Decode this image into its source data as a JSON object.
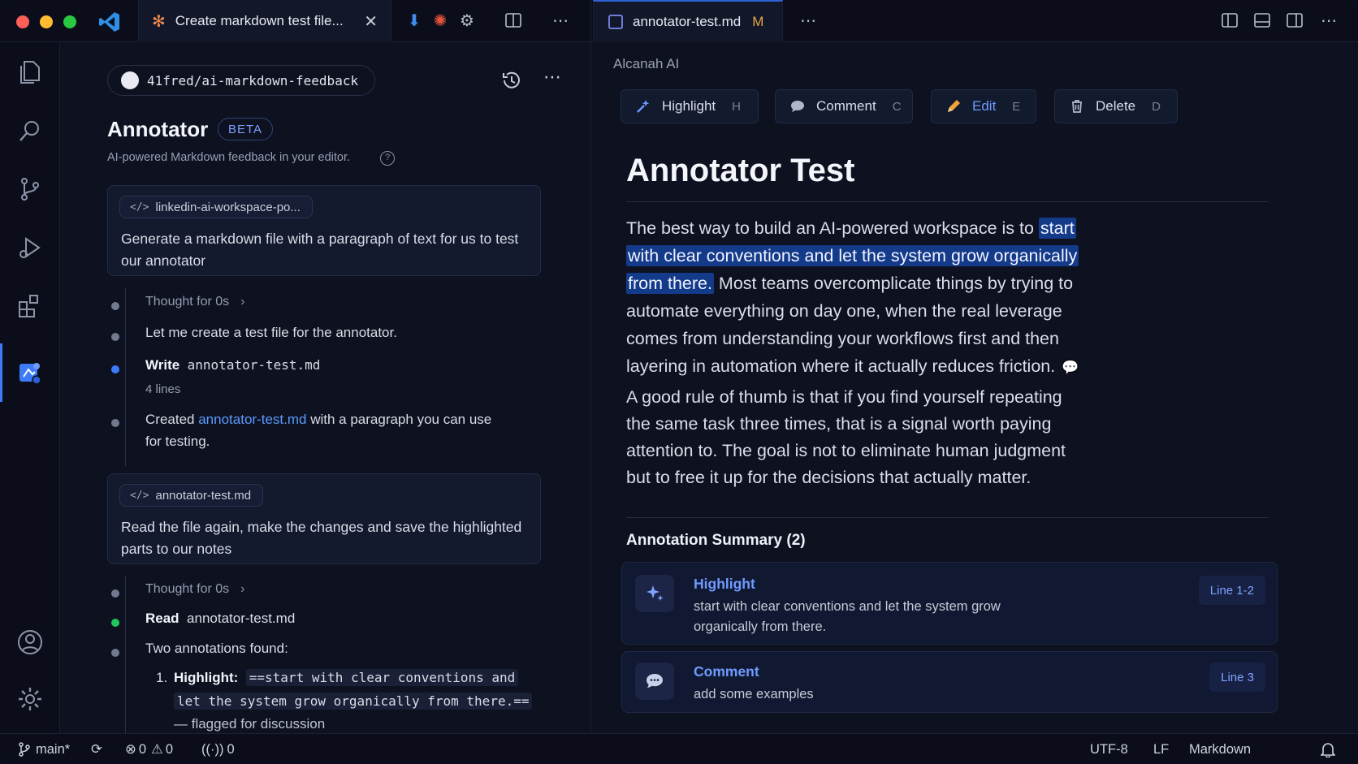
{
  "titlebar": {
    "left_tab_title": "Create markdown test file...",
    "right_tab_title": "annotator-test.md",
    "right_tab_status": "M"
  },
  "sidebar": {
    "repo": "41fred/ai-markdown-feedback",
    "title": "Annotator",
    "badge": "BETA",
    "subtitle": "AI-powered Markdown feedback in your editor.",
    "help": "?"
  },
  "chat": {
    "messages": [
      {
        "chip": "linkedin-ai-workspace-po...",
        "text": "Generate a markdown file with a paragraph of text for us to test our annotator"
      },
      {
        "chip": "annotator-test.md",
        "text": "Read the file again, make the changes and save the highlighted parts to our notes"
      }
    ],
    "steps1": {
      "thought": "Thought for 0s",
      "plan": "Let me create a test file for the annotator.",
      "write_label": "Write",
      "write_file": "annotator-test.md",
      "write_lines": "4 lines",
      "created_prefix": "Created",
      "created_link": "annotator-test.md",
      "created_suffix": "with a paragraph you can use",
      "created_suffix2": "for testing."
    },
    "steps2": {
      "thought": "Thought for 0s",
      "read_label": "Read",
      "read_file": "annotator-test.md",
      "found": "Two annotations found:",
      "item_num": "1.",
      "item_label": "Highlight:",
      "item_code1": "==start with clear conventions and",
      "item_code2": "let the system grow organically from there.==",
      "item_trail": "— flagged for discussion"
    }
  },
  "editor": {
    "breadcrumb": "Alcanah AI",
    "toolbar": [
      {
        "label": "Highlight",
        "key": "H"
      },
      {
        "label": "Comment",
        "key": "C"
      },
      {
        "label": "Edit",
        "key": "E"
      },
      {
        "label": "Delete",
        "key": "D"
      }
    ],
    "doc_title": "Annotator Test",
    "p1_pre": "The best way to build an AI-powered workspace is to ",
    "p1_hl1": "start",
    "p1_hl2": "with clear conventions and let the system grow organically",
    "p1_hl3": "from there.",
    "p1_post": " Most teams overcomplicate things by trying to automate everything on day one, when the real leverage comes from understanding your workflows first and then layering in automation where it actually reduces friction.",
    "p2": "A good rule of thumb is that if you find yourself repeating the same task three times, that is a signal worth paying attention to. The goal is not to eliminate human judgment but to free it up for the decisions that actually matter.",
    "summary_title": "Annotation Summary (2)",
    "annotations": [
      {
        "kind": "Highlight",
        "text": "start with clear conventions and let the system grow organically from there.",
        "line": "Line 1-2"
      },
      {
        "kind": "Comment",
        "text": "add some examples",
        "line": "Line 3"
      }
    ]
  },
  "statusbar": {
    "branch": "main*",
    "errors": "0",
    "warnings": "0",
    "ports": "0",
    "encoding": "UTF-8",
    "eol": "LF",
    "language": "Markdown"
  },
  "colors": {
    "accent": "#3d7bf7",
    "highlight": "#143a8a",
    "modified": "#e3a847",
    "success": "#22c55e"
  }
}
